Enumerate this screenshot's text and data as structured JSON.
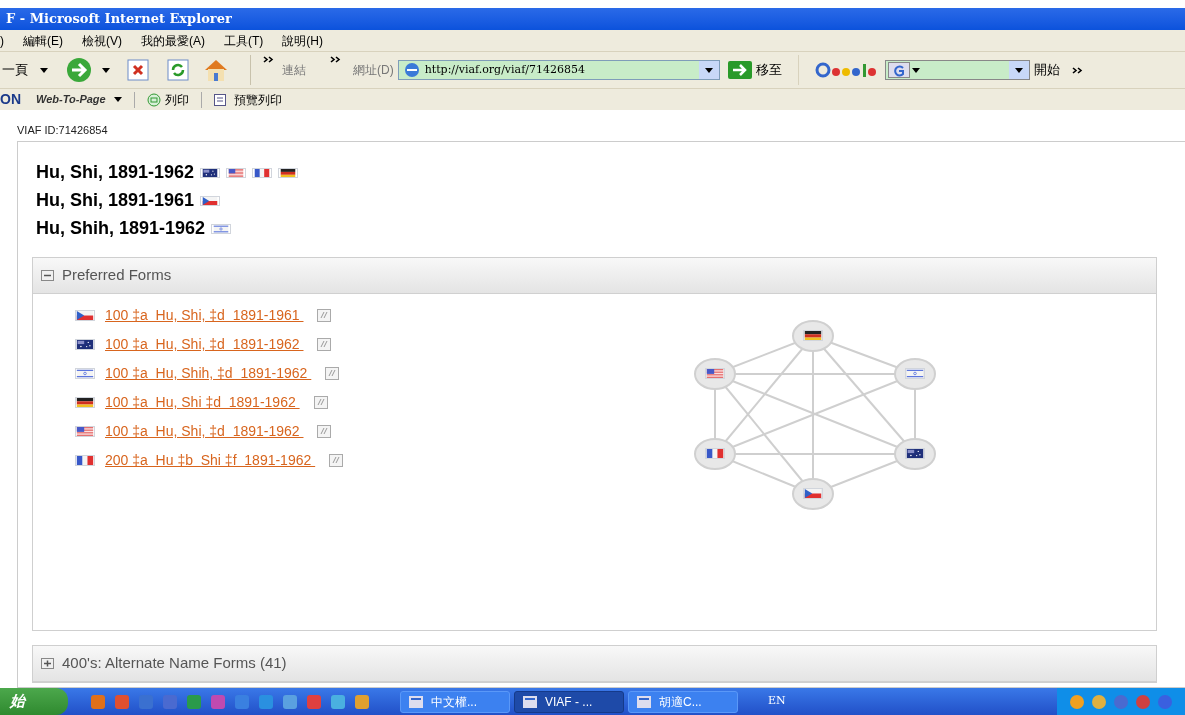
{
  "window": {
    "title": "F - Microsoft Internet Explorer"
  },
  "menu": [
    ")",
    "編輯(E)",
    "檢視(V)",
    "我的最愛(A)",
    "工具(T)",
    "說明(H)"
  ],
  "toolbar": {
    "back": "一頁",
    "links_label": "連結",
    "address_label": "網址(D)",
    "address": "http://viaf.org/viaf/71426854",
    "go": "移至",
    "search_start": "開始"
  },
  "toolbar2": {
    "web_to_page": "Web-To-Page",
    "print": "列印",
    "preview": "預覽列印",
    "brand": "ON"
  },
  "viaf_id": "VIAF ID:71426854",
  "headings": [
    {
      "text": "Hu, Shi, 1891-1962",
      "flags": [
        {
          "kind": "australia"
        },
        {
          "kind": "usa"
        },
        {
          "kind": "france"
        },
        {
          "kind": "germany"
        }
      ]
    },
    {
      "text": "Hu, Shi, 1891-1961",
      "flags": [
        {
          "kind": "czech"
        }
      ]
    },
    {
      "text": "Hu, Shih, 1891-1962",
      "flags": [
        {
          "kind": "israel"
        }
      ]
    }
  ],
  "preferred": {
    "title": "Preferred Forms",
    "expanded": true,
    "forms": [
      {
        "kind": "czech",
        "text": "100 ‡a  Hu, Shi, ‡d  1891-1961 "
      },
      {
        "kind": "australia",
        "text": "100 ‡a  Hu, Shi, ‡d  1891-1962 "
      },
      {
        "kind": "israel",
        "text": "100 ‡a  Hu, Shih, ‡d  1891-1962 "
      },
      {
        "kind": "germany",
        "text": "100 ‡a  Hu, Shi ‡d  1891-1962 "
      },
      {
        "kind": "usa",
        "text": "100 ‡a  Hu, Shi, ‡d  1891-1962 "
      },
      {
        "kind": "france",
        "text": "200 ‡a  Hu ‡b  Shi ‡f  1891-1962 "
      }
    ],
    "graph": {
      "nodes": [
        {
          "kind": "germany"
        },
        {
          "kind": "israel"
        },
        {
          "kind": "australia"
        },
        {
          "kind": "czech"
        },
        {
          "kind": "france"
        },
        {
          "kind": "usa"
        }
      ]
    }
  },
  "alternate": {
    "title": "400's: Alternate Name Forms (41)",
    "expanded": false
  },
  "taskbar": {
    "start": "始",
    "tasks": [
      {
        "label": "中文權...",
        "selected": false
      },
      {
        "label": "VIAF - ...",
        "selected": true
      },
      {
        "label": "胡適C...",
        "selected": false
      }
    ],
    "lang": "EN"
  }
}
